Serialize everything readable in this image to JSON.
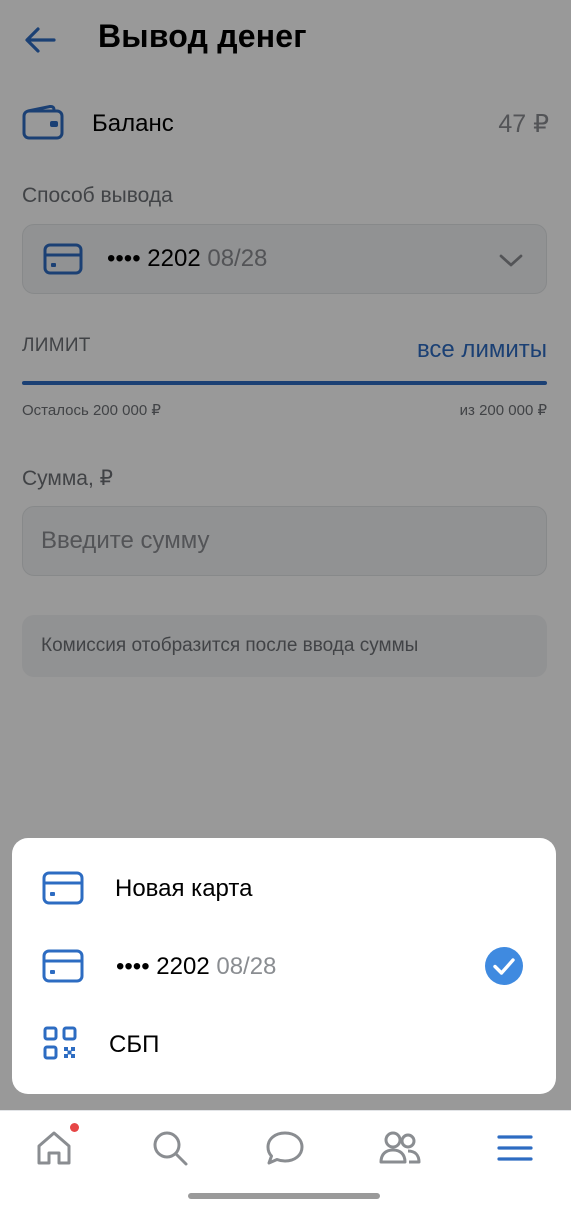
{
  "header": {
    "title": "Вывод денег",
    "back_icon": "arrow-left-icon"
  },
  "balance": {
    "label": "Баланс",
    "value": "47 ₽",
    "icon": "wallet-icon"
  },
  "withdrawal_method": {
    "label": "Способ вывода",
    "selected_card_mask": "•••• 2202",
    "selected_card_expiry": "08/28",
    "icon": "card-icon",
    "dropdown_icon": "chevron-down-icon"
  },
  "limit": {
    "title": "ЛИМИТ",
    "link_label": "все лимиты",
    "remaining": "Осталось 200 000 ₽",
    "total": "из 200 000 ₽",
    "progress_fraction": 1.0
  },
  "amount": {
    "label": "Сумма, ₽",
    "placeholder": "Введите сумму",
    "value": ""
  },
  "commission": {
    "text": "Комиссия отобразится после ввода суммы"
  },
  "sheet": {
    "items": [
      {
        "label": "Новая карта",
        "icon": "card-icon",
        "selected": false
      },
      {
        "label": "•••• 2202",
        "expiry": "08/28",
        "icon": "card-icon",
        "selected": true
      },
      {
        "label": "СБП",
        "icon": "qr-code-icon",
        "selected": false
      }
    ]
  },
  "tabbar": {
    "tabs": [
      {
        "name": "home",
        "icon": "home-icon",
        "has_badge": true
      },
      {
        "name": "search",
        "icon": "search-icon",
        "has_badge": false
      },
      {
        "name": "messages",
        "icon": "chat-icon",
        "has_badge": false
      },
      {
        "name": "friends",
        "icon": "users-icon",
        "has_badge": false
      },
      {
        "name": "menu",
        "icon": "menu-icon",
        "has_badge": false
      }
    ]
  },
  "colors": {
    "accent": "#2d6cc2",
    "check": "#3f8ae0",
    "badge": "#e64646",
    "secondary_text": "#6d7075",
    "field_bg": "#f2f3f5"
  }
}
